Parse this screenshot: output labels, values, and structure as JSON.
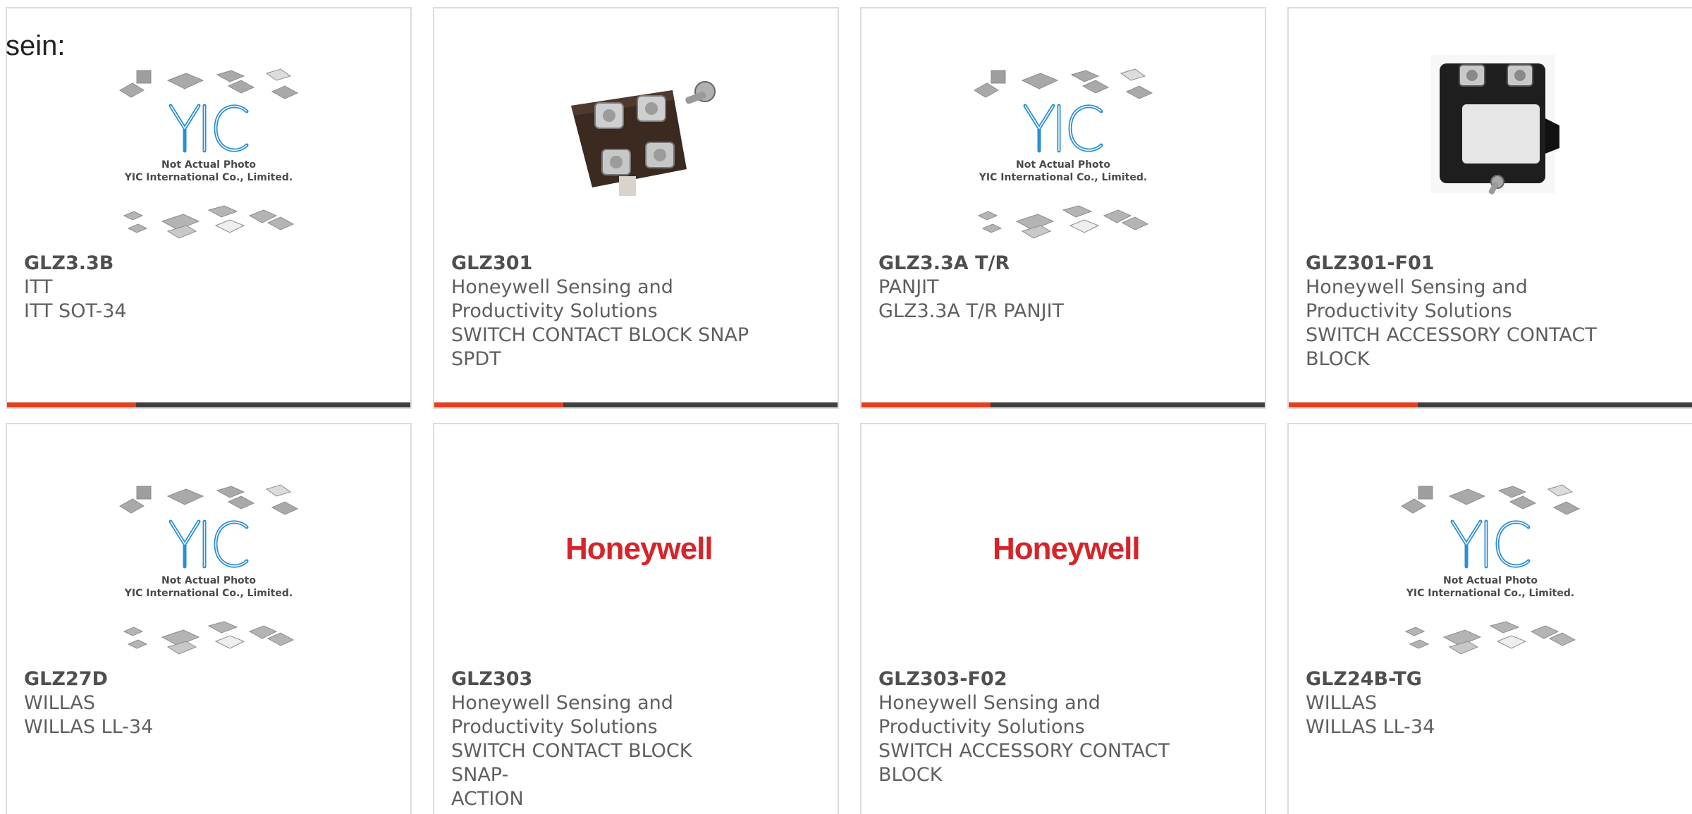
{
  "lead_text": "sein:",
  "colors": {
    "accent": "#e2401f",
    "bar": "#3f3f3f",
    "card_border": "#dcdcdc",
    "text": "#5f5f5f",
    "honeywell_red": "#d6242a",
    "yic_blue": "#2b8fd4"
  },
  "placeholder": {
    "brand": "YIC",
    "caption1": "Not Actual Photo",
    "caption2": "YIC International Co., Limited."
  },
  "honeywell_logo": "Honeywell",
  "products": [
    {
      "mpn": "GLZ3.3B",
      "image": "yic-placeholder",
      "lines": [
        "ITT",
        "ITT SOT-34"
      ]
    },
    {
      "mpn": "GLZ301",
      "image": "contact-block-photo",
      "lines": [
        "Honeywell Sensing and",
        "Productivity Solutions",
        "SWITCH CONTACT BLOCK SNAP",
        "SPDT"
      ]
    },
    {
      "mpn": "GLZ3.3A T/R",
      "image": "yic-placeholder",
      "lines": [
        "PANJIT",
        "GLZ3.3A T/R PANJIT"
      ]
    },
    {
      "mpn": "GLZ301-F01",
      "image": "accessory-contact-block-photo",
      "lines": [
        "Honeywell Sensing and",
        "Productivity Solutions",
        "SWITCH ACCESSORY CONTACT",
        "BLOCK"
      ]
    },
    {
      "mpn": "GLZ27D",
      "image": "yic-placeholder",
      "lines": [
        "WILLAS",
        "WILLAS LL-34"
      ]
    },
    {
      "mpn": "GLZ303",
      "image": "honeywell-logo",
      "lines": [
        "Honeywell Sensing and",
        "Productivity Solutions",
        "SWITCH CONTACT BLOCK SNAP-",
        "ACTION"
      ]
    },
    {
      "mpn": "GLZ303-F02",
      "image": "honeywell-logo",
      "lines": [
        "Honeywell Sensing and",
        "Productivity Solutions",
        "SWITCH ACCESSORY CONTACT",
        "BLOCK"
      ]
    },
    {
      "mpn": "GLZ24B-TG",
      "image": "yic-placeholder",
      "lines": [
        "WILLAS",
        "WILLAS LL-34"
      ]
    }
  ]
}
